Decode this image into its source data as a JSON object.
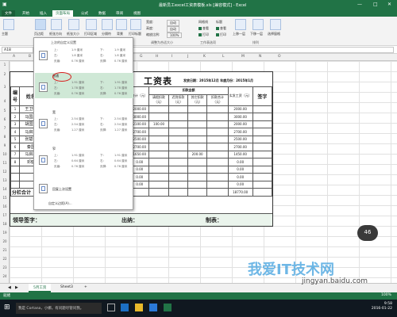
{
  "window": {
    "title": "最新员工excel工资表模板.xls [兼容模式] - Excel",
    "min": "—",
    "max": "□",
    "close": "✕"
  },
  "tabs": [
    {
      "label": "文件"
    },
    {
      "label": "开始"
    },
    {
      "label": "插入"
    },
    {
      "label": "页面布局"
    },
    {
      "label": "公式"
    },
    {
      "label": "数据"
    },
    {
      "label": "审阅"
    },
    {
      "label": "视图"
    }
  ],
  "ribbon": {
    "buttons": [
      {
        "label": "主题"
      },
      {
        "label": "页边距"
      },
      {
        "label": "纸张方向"
      },
      {
        "label": "纸张大小"
      },
      {
        "label": "打印区域"
      },
      {
        "label": "分隔符"
      },
      {
        "label": "背景"
      },
      {
        "label": "打印标题"
      }
    ],
    "scale": {
      "width_label": "宽度:",
      "width_val": "自动",
      "height_label": "高度:",
      "height_val": "自动",
      "ratio_label": "缩放比例:",
      "ratio_val": "100%"
    },
    "sheet_opts": {
      "gridlines": "网格线",
      "headings": "标题",
      "view": "查看",
      "print": "打印"
    },
    "arrange": [
      {
        "label": "上移一层"
      },
      {
        "label": "下移一层"
      },
      {
        "label": "选择窗格"
      }
    ],
    "groups": {
      "scale": "调整为合适大小",
      "sheet_opts": "工作表选项",
      "arrange": "排列"
    }
  },
  "formula_bar": {
    "name_box": "A18"
  },
  "columns": [
    "A",
    "B",
    "C",
    "D",
    "E",
    "F",
    "G",
    "H",
    "I",
    "J",
    "K",
    "L",
    "M",
    "N",
    "O"
  ],
  "rows": [
    "1",
    "2",
    "3",
    "4",
    "5",
    "6",
    "7",
    "8",
    "9",
    "10",
    "11",
    "12",
    "13",
    "14",
    "15",
    "16",
    "17",
    "18",
    "19",
    "20",
    "21",
    "22",
    "23",
    "24",
    "25",
    "26",
    "27",
    "28",
    "29"
  ],
  "margins_menu": {
    "header": "上次的自定义设置",
    "items": [
      {
        "name": "",
        "top_label": "上:",
        "top": "1.9 厘米",
        "bottom_label": "下:",
        "bottom": "1.9 厘米",
        "left_label": "左:",
        "left": "1.8 厘米",
        "right_label": "右:",
        "right": "1.8 厘米",
        "header_label": "页眉:",
        "header_val": "0.76 厘米",
        "footer_label": "页脚:",
        "footer_val": "0.76 厘米"
      },
      {
        "name": "普通",
        "top_label": "上:",
        "top": "1.91 厘米",
        "bottom_label": "下:",
        "bottom": "1.91 厘米",
        "left_label": "左:",
        "left": "1.78 厘米",
        "right_label": "右:",
        "right": "1.78 厘米",
        "header_label": "页眉:",
        "header_val": "0.76 厘米",
        "footer_label": "页脚:",
        "footer_val": "0.76 厘米"
      },
      {
        "name": "宽",
        "top_label": "上:",
        "top": "2.54 厘米",
        "bottom_label": "下:",
        "bottom": "2.54 厘米",
        "left_label": "左:",
        "left": "2.54 厘米",
        "right_label": "右:",
        "right": "2.54 厘米",
        "header_label": "页眉:",
        "header_val": "1.27 厘米",
        "footer_label": "页脚:",
        "footer_val": "1.27 厘米"
      },
      {
        "name": "窄",
        "top_label": "上:",
        "top": "1.91 厘米",
        "bottom_label": "下:",
        "bottom": "1.91 厘米",
        "left_label": "左:",
        "left": "0.64 厘米",
        "right_label": "右:",
        "right": "0.64 厘米",
        "header_label": "页眉:",
        "header_val": "0.76 厘米",
        "footer_label": "页脚:",
        "footer_val": "0.76 厘米"
      }
    ],
    "custom_name": "回复上次设置",
    "custom_link": "自定义边距(A)..."
  },
  "salary": {
    "title": "工资表",
    "date": "发放日期：2015年12月  年度月份：2015年1月",
    "head_no": "编号",
    "head_name": "姓名",
    "head_deduct": "扣款金额",
    "head_sum": "合计（元）",
    "deduct_cols": [
      "请假扣款（元）",
      "迟到扣款（元）",
      "其它扣款（元）",
      "扣款合计（元）"
    ],
    "head_net": "实发工资（元）",
    "head_sign": "签字",
    "rows": [
      {
        "no": "1",
        "name": "王卫明",
        "sum": "2000.00",
        "d1": "",
        "d2": "",
        "d3": "",
        "dt": "",
        "net": "2000.00"
      },
      {
        "no": "2",
        "name": "马国鑫",
        "sum": "3000.00",
        "d1": "",
        "d2": "",
        "d3": "",
        "dt": "",
        "net": "3000.00"
      },
      {
        "no": "3",
        "name": "胡国斌",
        "sum": "2100.00",
        "d1": "100.00",
        "d2": "",
        "d3": "",
        "dt": "",
        "net": "2000.00"
      },
      {
        "no": "4",
        "name": "马启竣",
        "sum": "2700.00",
        "d1": "",
        "d2": "",
        "d3": "",
        "dt": "",
        "net": "2700.00"
      },
      {
        "no": "5",
        "name": "张楚琴",
        "sum": "2500.00",
        "d1": "",
        "d2": "",
        "d3": "",
        "dt": "",
        "net": "2500.00"
      },
      {
        "no": "6",
        "name": "秦国",
        "sum": "2700.00",
        "d1": "",
        "d2": "",
        "d3": "",
        "dt": "",
        "net": "2700.00"
      },
      {
        "no": "7",
        "name": "马启雄",
        "sum": "1650.00",
        "d1": "",
        "d2": "",
        "d3": "200.00",
        "dt": "",
        "net": "1450.00"
      },
      {
        "no": "8",
        "name": "邓健",
        "sum": "0.00",
        "d1": "",
        "d2": "",
        "d3": "",
        "dt": "",
        "net": "0.00"
      },
      {
        "no": "",
        "name": "",
        "sum": "0.00",
        "d1": "",
        "d2": "",
        "d3": "",
        "dt": "",
        "net": "0.00"
      },
      {
        "no": "",
        "name": "",
        "sum": "0.00",
        "d1": "",
        "d2": "",
        "d3": "",
        "dt": "",
        "net": "0.00"
      },
      {
        "no": "",
        "name": "",
        "sum": "0.00",
        "d1": "",
        "d2": "",
        "d3": "",
        "dt": "",
        "net": "0.00"
      }
    ],
    "total_label": "分栏合计",
    "total_val": "18770.00",
    "footer_leader": "领导签字：",
    "footer_cashier": "出纳：",
    "footer_maker": "制表："
  },
  "sheet_tabs": [
    {
      "label": "5月工资"
    },
    {
      "label": "Sheet3"
    }
  ],
  "add_sheet": "+",
  "status": {
    "ready": "就绪",
    "zoom": "100%"
  },
  "taskbar": {
    "search": "我是 Cortana，小娜。有问题尽管问我。",
    "time": "9:58",
    "date": "2016-01-22"
  },
  "badge": "46",
  "watermark": {
    "brand": "我爱IT技术网",
    "url": "jingyan.baidu.com"
  },
  "colors": {
    "excel_green": "#217346",
    "selected_item": "#cfe8d6",
    "circle": "#d81e1e"
  }
}
